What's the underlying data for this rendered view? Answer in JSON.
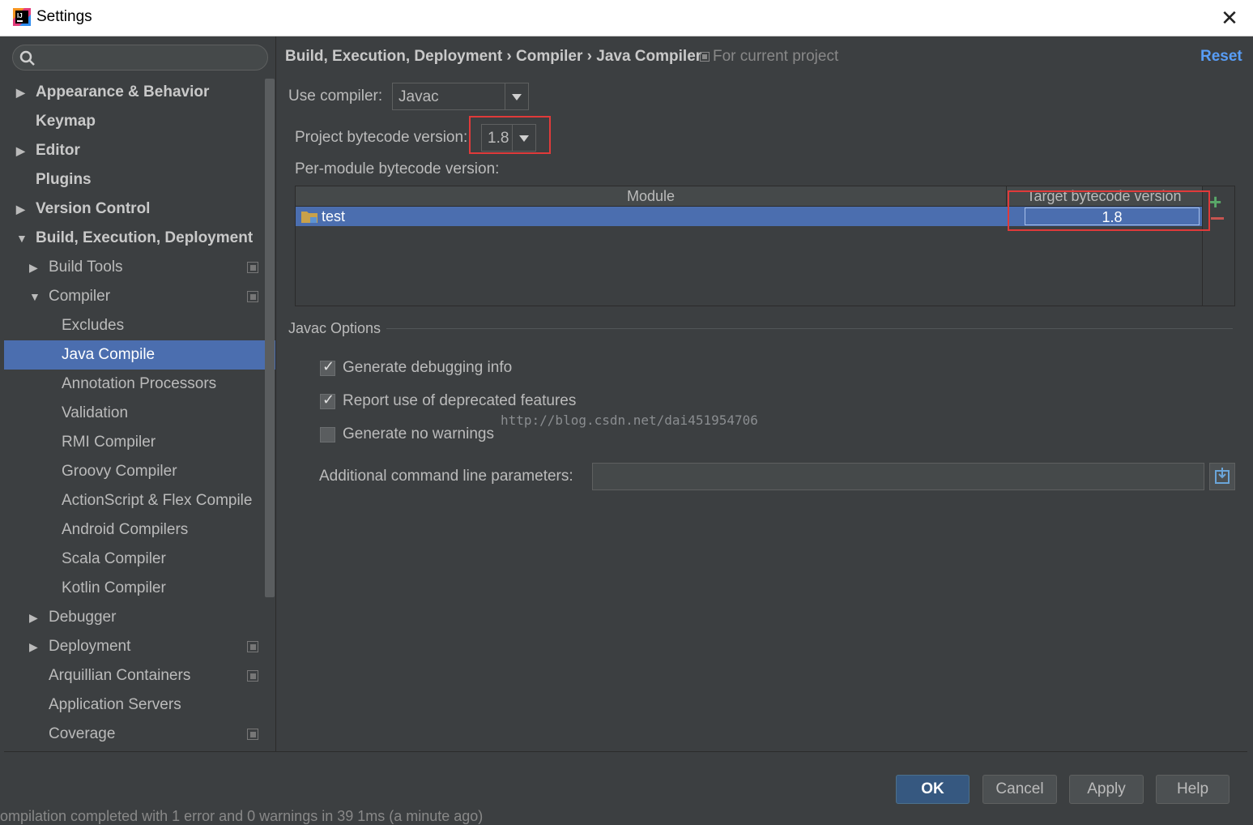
{
  "window": {
    "title": "Settings",
    "close_glyph": "✕"
  },
  "search": {
    "placeholder": ""
  },
  "sidebar": {
    "items": [
      {
        "label": "Appearance & Behavior",
        "level": 0,
        "arrow": "▶",
        "bold": true
      },
      {
        "label": "Keymap",
        "level": 0,
        "arrow": "",
        "bold": true
      },
      {
        "label": "Editor",
        "level": 0,
        "arrow": "▶",
        "bold": true
      },
      {
        "label": "Plugins",
        "level": 0,
        "arrow": "",
        "bold": true
      },
      {
        "label": "Version Control",
        "level": 0,
        "arrow": "▶",
        "bold": true
      },
      {
        "label": "Build, Execution, Deployment",
        "level": 0,
        "arrow": "▼",
        "bold": true
      },
      {
        "label": "Build Tools",
        "level": 1,
        "arrow": "▶",
        "project": true
      },
      {
        "label": "Compiler",
        "level": 1,
        "arrow": "▼",
        "project": true
      },
      {
        "label": "Excludes",
        "level": 2,
        "arrow": ""
      },
      {
        "label": "Java Compile",
        "level": 2,
        "arrow": "",
        "selected": true
      },
      {
        "label": "Annotation Processors",
        "level": 2,
        "arrow": ""
      },
      {
        "label": "Validation",
        "level": 2,
        "arrow": ""
      },
      {
        "label": "RMI Compiler",
        "level": 2,
        "arrow": ""
      },
      {
        "label": "Groovy Compiler",
        "level": 2,
        "arrow": ""
      },
      {
        "label": "ActionScript & Flex Compile",
        "level": 2,
        "arrow": ""
      },
      {
        "label": "Android Compilers",
        "level": 2,
        "arrow": ""
      },
      {
        "label": "Scala Compiler",
        "level": 2,
        "arrow": ""
      },
      {
        "label": "Kotlin Compiler",
        "level": 2,
        "arrow": ""
      },
      {
        "label": "Debugger",
        "level": 1,
        "arrow": "▶"
      },
      {
        "label": "Deployment",
        "level": 1,
        "arrow": "▶",
        "project": true
      },
      {
        "label": "Arquillian Containers",
        "level": 1,
        "arrow": "",
        "project": true
      },
      {
        "label": "Application Servers",
        "level": 1,
        "arrow": ""
      },
      {
        "label": "Coverage",
        "level": 1,
        "arrow": "",
        "project": true
      }
    ]
  },
  "header": {
    "breadcrumb": "Build, Execution, Deployment › Compiler › Java Compiler",
    "scope": "For current project",
    "reset": "Reset"
  },
  "compiler": {
    "use_label": "Use compiler:",
    "use_value": "Javac",
    "project_bytecode_label": "Project bytecode version:",
    "project_bytecode_value": "1.8",
    "per_module_label": "Per-module bytecode version:"
  },
  "module_table": {
    "columns": [
      "Module",
      "Target bytecode version"
    ],
    "rows": [
      {
        "module": "test",
        "version": "1.8"
      }
    ],
    "add": "+"
  },
  "javac": {
    "section_title": "Javac Options",
    "options": [
      {
        "label": "Generate debugging info",
        "checked": true
      },
      {
        "label": "Report use of deprecated features",
        "checked": true
      },
      {
        "label": "Generate no warnings",
        "checked": false
      }
    ],
    "additional_label": "Additional command line parameters:",
    "additional_value": ""
  },
  "watermark": "http://blog.csdn.net/dai451954706",
  "footer": {
    "ok": "OK",
    "cancel": "Cancel",
    "apply": "Apply",
    "help": "Help"
  },
  "statusbar": "ompilation completed with 1 error and 0 warnings in 39 1ms (a minute ago)",
  "colors": {
    "accent": "#4b6eaf",
    "link": "#589df6",
    "highlight_box": "#e03a3a",
    "background": "#3c3f41"
  }
}
